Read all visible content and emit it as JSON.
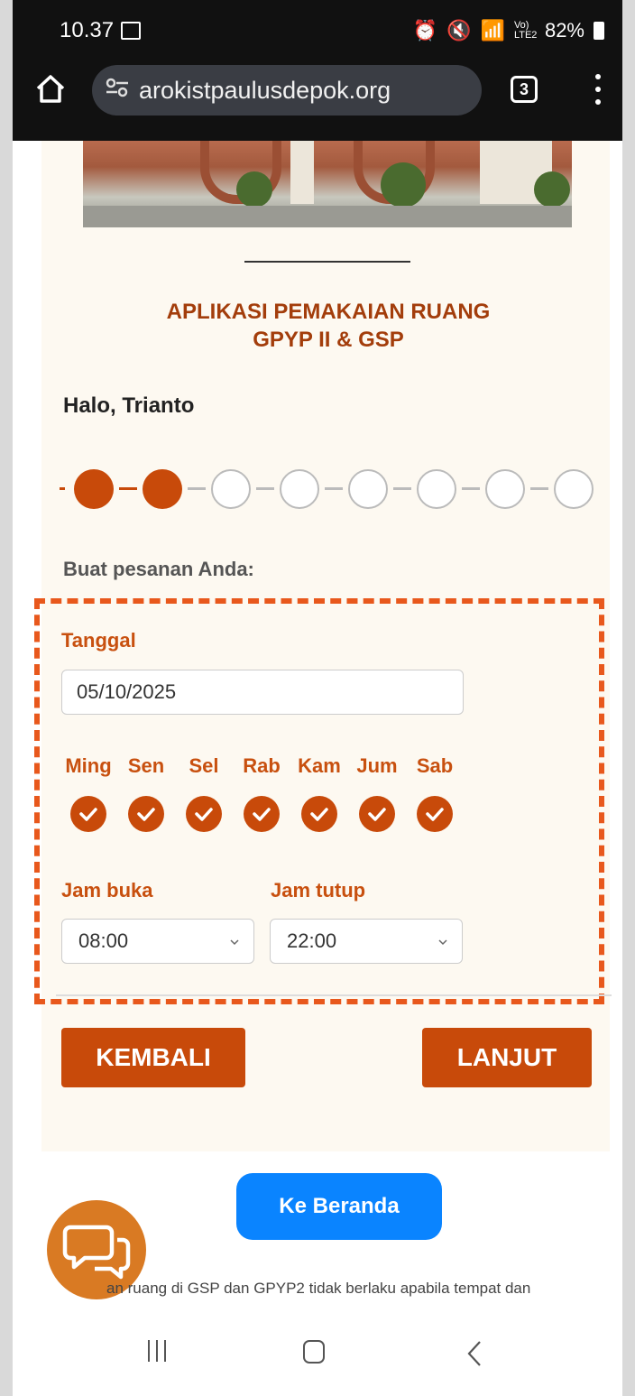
{
  "status_bar": {
    "time": "10.37",
    "battery": "82%",
    "network": "Vo) LTE2"
  },
  "browser": {
    "url": "arokistpaulusdepok.org",
    "tab_count": "3"
  },
  "page": {
    "title_line1": "APLIKASI PEMAKAIAN RUANG",
    "title_line2": "GPYP II & GSP",
    "greeting": "Halo, Trianto",
    "steps": {
      "total": 8,
      "completed": 2
    },
    "prompt": "Buat pesanan Anda:"
  },
  "form": {
    "date_label": "Tanggal",
    "date_value": "05/10/2025",
    "days": [
      {
        "label": "Ming",
        "checked": true
      },
      {
        "label": "Sen",
        "checked": true
      },
      {
        "label": "Sel",
        "checked": true
      },
      {
        "label": "Rab",
        "checked": true
      },
      {
        "label": "Kam",
        "checked": true
      },
      {
        "label": "Jum",
        "checked": true
      },
      {
        "label": "Sab",
        "checked": true
      }
    ],
    "open_label": "Jam buka",
    "open_value": "08:00",
    "close_label": "Jam tutup",
    "close_value": "22:00"
  },
  "actions": {
    "back_label": "KEMBALI",
    "next_label": "LANJUT",
    "home_label": "Ke Beranda"
  },
  "footer": {
    "note": "an ruang di GSP dan GPYP2 tidak berlaku apabila tempat dan"
  },
  "colors": {
    "accent": "#c84a0a",
    "highlight_border": "#e8581c",
    "home_button": "#0a84ff",
    "chat_bubble": "#d97a23"
  },
  "icons": [
    "home-icon",
    "site-settings-icon",
    "tabs-icon",
    "menu-icon",
    "check-icon",
    "chevron-down-icon",
    "chat-icon",
    "recent-apps-icon",
    "nav-home-icon",
    "back-icon"
  ]
}
